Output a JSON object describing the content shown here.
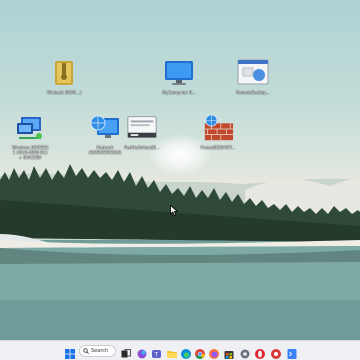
{
  "desktop": {
    "icons": [
      {
        "name": "archive-icon",
        "label": "Winback [OSM...]"
      },
      {
        "name": "computer-icon",
        "label": "MyComputer [I..."
      },
      {
        "name": "remote-desktop-icon",
        "label": "RemoteDeskop..."
      },
      {
        "name": "network-connection-icon",
        "label": "Windows [GOSSE]\n1 (WLD-4006-R1)\n+ 0042580"
      },
      {
        "name": "network-globe-icon",
        "label": "Network\n(WORKSTATION)"
      },
      {
        "name": "console-window-icon",
        "label": "RedHatfolium[B..."
      },
      {
        "name": "firewall-icon",
        "label": "Firewall[DEMOT..."
      }
    ]
  },
  "taskbar": {
    "search_label": "Search",
    "apps": [
      "windows-start",
      "search",
      "task-view",
      "copilot",
      "teams",
      "file-explorer",
      "edge",
      "chrome",
      "firefox",
      "opera",
      "store",
      "settings",
      "game",
      "terminal"
    ]
  }
}
